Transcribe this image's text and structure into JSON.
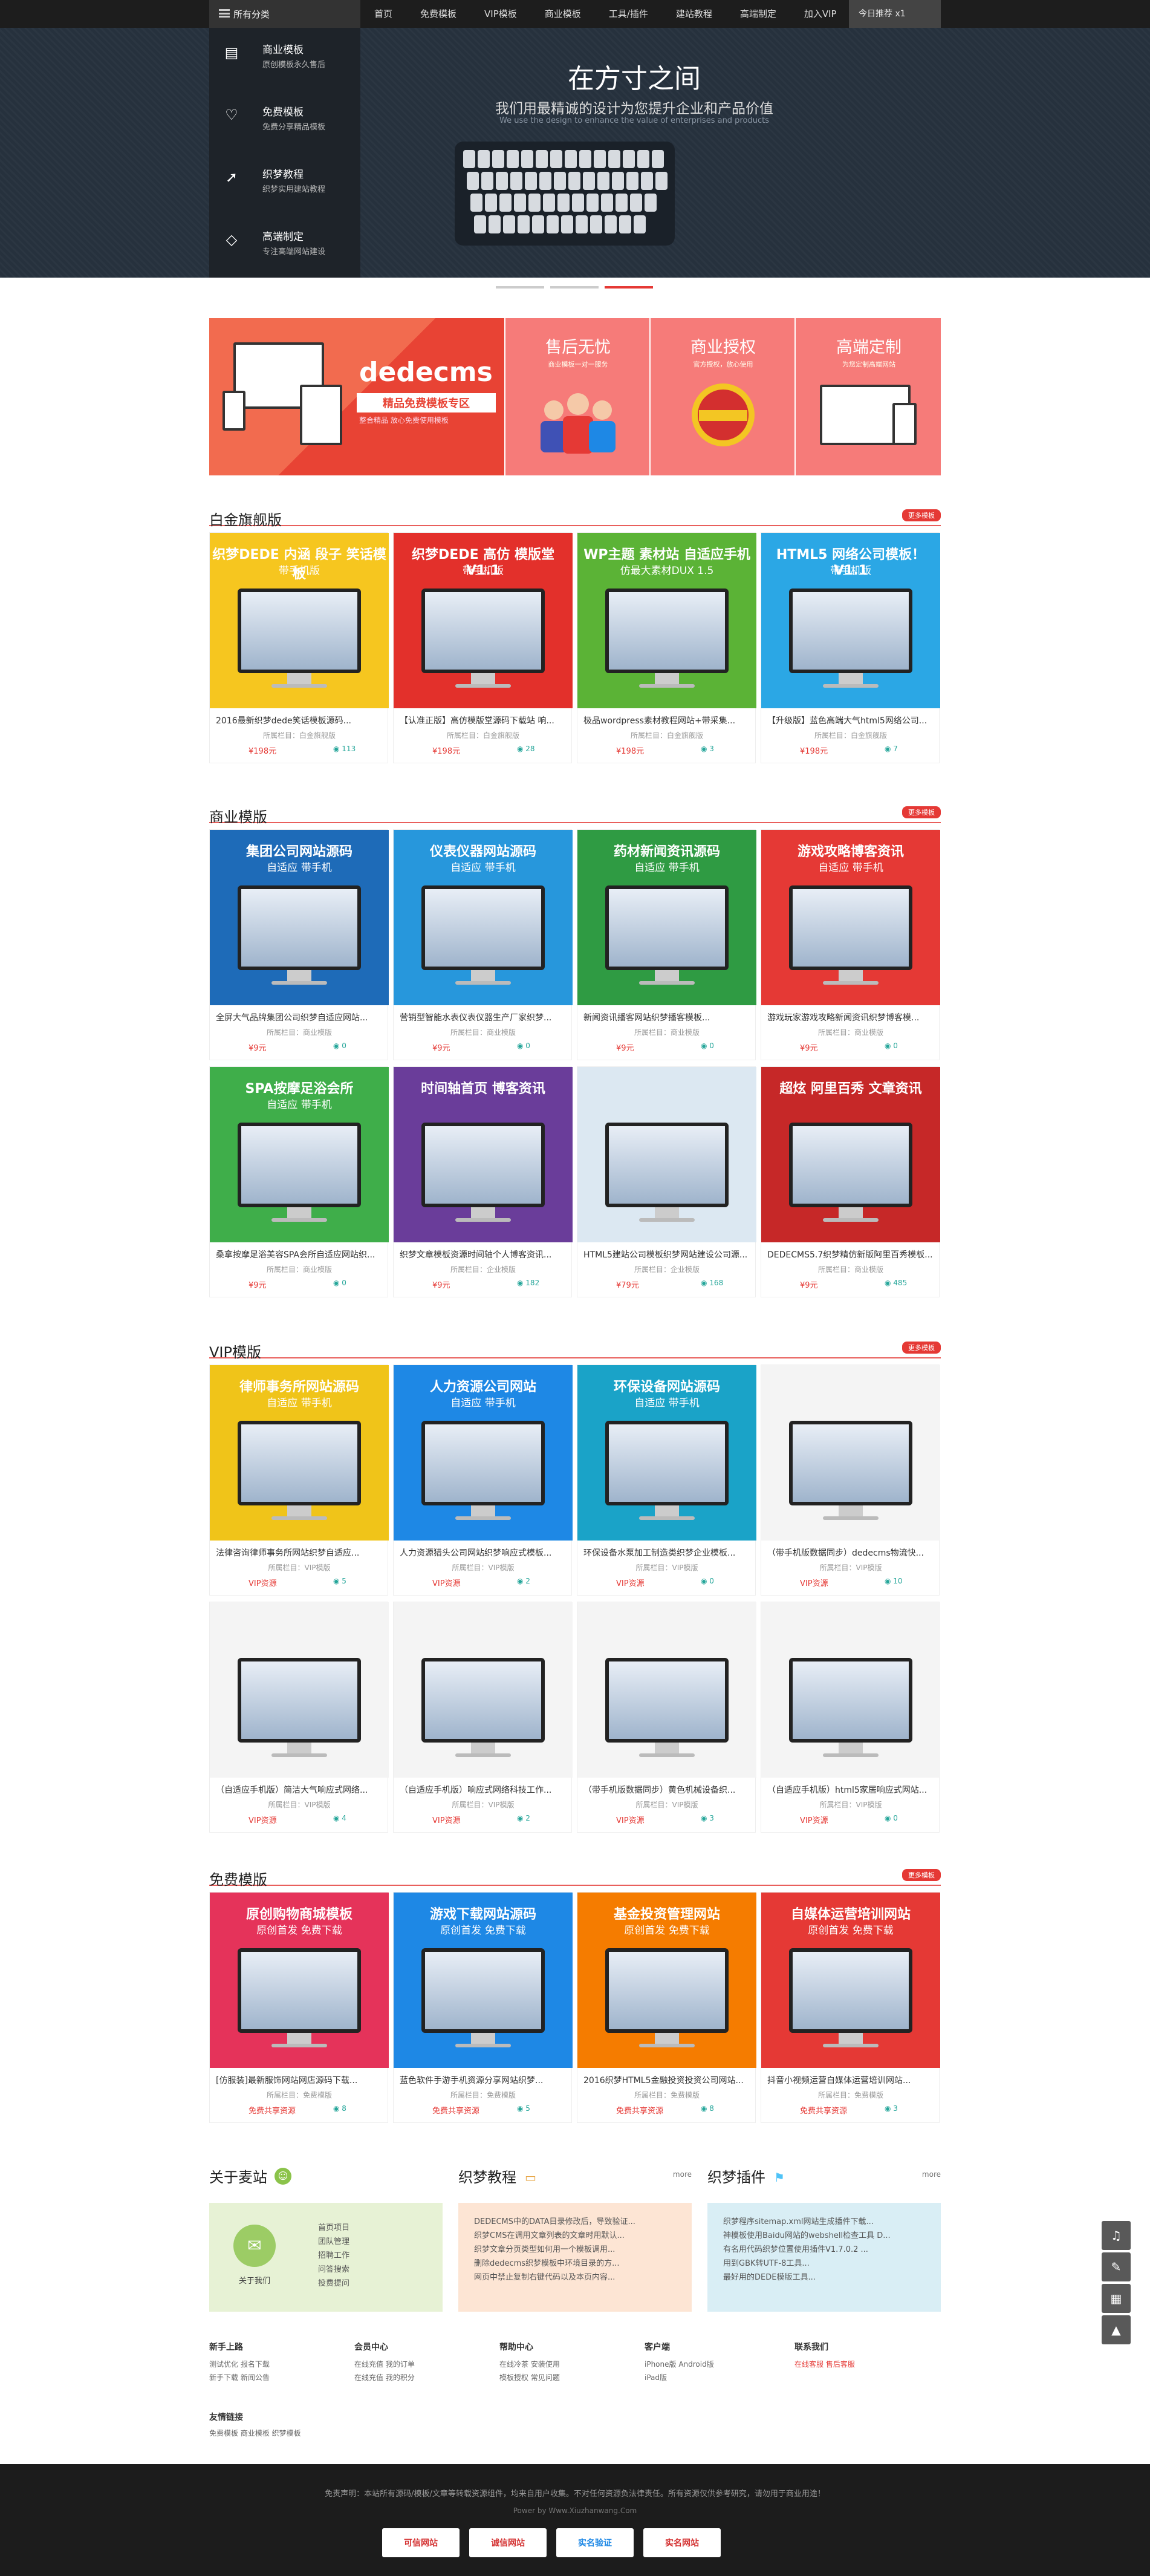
{
  "topnav": {
    "all_categories": "所有分类",
    "items": [
      "首页",
      "免费模板",
      "VIP模板",
      "商业模板",
      "工具/插件",
      "建站教程",
      "高端制定",
      "加入VIP"
    ],
    "today": "今日推荐 x1"
  },
  "hero": {
    "title": "在方寸之间",
    "subtitle": "我们用最精诚的设计为您提升企业和产品价值",
    "en": "We use the design to enhance the value of enterprises and products"
  },
  "sidecat": [
    {
      "icon": "doc-icon",
      "title": "商业模板",
      "desc": "原创模板永久售后"
    },
    {
      "icon": "heart-icon",
      "title": "免费模板",
      "desc": "免费分享精品模板"
    },
    {
      "icon": "cursor-icon",
      "title": "织梦教程",
      "desc": "织梦实用建站教程"
    },
    {
      "icon": "diamond-icon",
      "title": "高端制定",
      "desc": "专注高端网站建设"
    }
  ],
  "promo": {
    "dedecms": "dedecms",
    "dede_sub": "精品免费模板专区",
    "dede_sub2": "整合精品  放心免费使用模板",
    "cols": [
      {
        "h": "售后无忧",
        "s": "商业模板一对一服务"
      },
      {
        "h": "商业授权",
        "s": "官方授权，放心使用"
      },
      {
        "h": "高端定制",
        "s": "为您定制高端网站"
      }
    ]
  },
  "sections": [
    {
      "name": "白金旗舰版",
      "more": "更多模板",
      "cards": [
        {
          "cap": "织梦DEDE 内涵 段子 笑话模板",
          "cap2": "带手机版",
          "bg": "#f6c61f",
          "title": "2016最新织梦dede笑话模板源码...",
          "cat": "所属栏目：白金旗舰版",
          "price": "¥198元",
          "stat": "113"
        },
        {
          "cap": "织梦DEDE 高仿 模版堂 V1.1",
          "cap2": "带手机版",
          "bg": "#e3302b",
          "title": "【认准正版】高仿模版堂源码下载站 响...",
          "cat": "所属栏目：白金旗舰版",
          "price": "¥198元",
          "stat": "28"
        },
        {
          "cap": "WP主题 素材站 自适应手机",
          "cap2": "仿最大素材DUX 1.5",
          "bg": "#5bb336",
          "title": "极品wordpress素材教程网站+带采集...",
          "cat": "所属栏目：白金旗舰版",
          "price": "¥198元",
          "stat": "3"
        },
        {
          "cap": "HTML5 网络公司模板！ V1.1",
          "cap2": "带手机版",
          "bg": "#2ba7e5",
          "title": "【升级版】蓝色高端大气html5网络公司...",
          "cat": "所属栏目：白金旗舰版",
          "price": "¥198元",
          "stat": "7"
        }
      ]
    },
    {
      "name": "商业模版",
      "more": "更多模板",
      "cards": [
        {
          "cap": "集团公司网站源码",
          "cap2": "自适应 带手机",
          "bg": "#1e6bb8",
          "title": "全屏大气品牌集团公司织梦自适应网站...",
          "cat": "所属栏目：商业模版",
          "price": "¥9元",
          "stat": "0"
        },
        {
          "cap": "仪表仪器网站源码",
          "cap2": "自适应 带手机",
          "bg": "#2797dc",
          "title": "营销型智能水表仪表仪器生产厂家织梦...",
          "cat": "所属栏目：商业模版",
          "price": "¥9元",
          "stat": "0"
        },
        {
          "cap": "药材新闻资讯源码",
          "cap2": "自适应 带手机",
          "bg": "#2f9b43",
          "title": "新闻资讯播客网站织梦播客模板...",
          "cat": "所属栏目：商业模版",
          "price": "¥9元",
          "stat": "0"
        },
        {
          "cap": "游戏攻略博客资讯",
          "cap2": "自适应 带手机",
          "bg": "#e53935",
          "title": "游戏玩家游戏攻略新闻资讯织梦博客模...",
          "cat": "所属栏目：商业模版",
          "price": "¥9元",
          "stat": "0"
        },
        {
          "cap": "SPA按摩足浴会所",
          "cap2": "自适应 带手机",
          "bg": "#3fae4a",
          "title": "桑拿按摩足浴美容SPA会所自适应网站织...",
          "cat": "所属栏目：商业模版",
          "price": "¥9元",
          "stat": "0"
        },
        {
          "cap": "时间轴首页 博客资讯",
          "cap2": "",
          "bg": "#6a3d9a",
          "title": "织梦文章模板资源时间轴个人博客资讯...",
          "cat": "所属栏目：企业模版",
          "price": "¥9元",
          "stat": "182"
        },
        {
          "cap": "",
          "cap2": "",
          "bg": "#dce8f2",
          "title": "HTML5建站公司模板织梦网站建设公司源...",
          "cat": "所属栏目：企业模版",
          "price": "¥79元",
          "stat": "168"
        },
        {
          "cap": "超炫 阿里百秀 文章资讯",
          "cap2": "",
          "bg": "#c62828",
          "title": "DEDECMS5.7织梦精仿新版阿里百秀模板...",
          "cat": "所属栏目：商业模版",
          "price": "¥9元",
          "stat": "485"
        }
      ]
    },
    {
      "name": "VIP模版",
      "more": "更多模板",
      "cards": [
        {
          "cap": "律师事务所网站源码",
          "cap2": "自适应 带手机",
          "bg": "#f0c419",
          "title": "法律咨询律师事务所网站织梦自适应...",
          "cat": "所属栏目：VIP模版",
          "price": "VIP资源",
          "stat": "5"
        },
        {
          "cap": "人力资源公司网站",
          "cap2": "自适应 带手机",
          "bg": "#1e88e5",
          "title": "人力资源猎头公司网站织梦响应式模板...",
          "cat": "所属栏目：VIP模版",
          "price": "VIP资源",
          "stat": "2"
        },
        {
          "cap": "环保设备网站源码",
          "cap2": "自适应 带手机",
          "bg": "#1aa3c8",
          "title": "环保设备水泵加工制造类织梦企业模板...",
          "cat": "所属栏目：VIP模版",
          "price": "VIP资源",
          "stat": "0"
        },
        {
          "cap": "",
          "cap2": "",
          "bg": "#f4f4f4",
          "title": "（带手机版数据同步）dedecms物流快...",
          "cat": "所属栏目：VIP模版",
          "price": "VIP资源",
          "stat": "10"
        },
        {
          "cap": "",
          "cap2": "",
          "bg": "#f4f4f4",
          "title": "（自适应手机版）简洁大气响应式网络...",
          "cat": "所属栏目：VIP模版",
          "price": "VIP资源",
          "stat": "4"
        },
        {
          "cap": "",
          "cap2": "",
          "bg": "#f4f4f4",
          "title": "（自适应手机版）响应式网络科技工作...",
          "cat": "所属栏目：VIP模版",
          "price": "VIP资源",
          "stat": "2"
        },
        {
          "cap": "",
          "cap2": "",
          "bg": "#f4f4f4",
          "title": "（带手机版数据同步）黄色机械设备织...",
          "cat": "所属栏目：VIP模版",
          "price": "VIP资源",
          "stat": "3"
        },
        {
          "cap": "",
          "cap2": "",
          "bg": "#f4f4f4",
          "title": "（自适应手机版）html5家居响应式网站...",
          "cat": "所属栏目：VIP模版",
          "price": "VIP资源",
          "stat": "0"
        }
      ]
    },
    {
      "name": "免费模版",
      "more": "更多模板",
      "cards": [
        {
          "cap": "原创购物商城模板",
          "cap2": "原创首发  免费下载",
          "bg": "#e5335a",
          "title": "[仿服装]最新服饰网站网店源码下载...",
          "cat": "所属栏目：免费模版",
          "price": "免费共享资源",
          "stat": "8"
        },
        {
          "cap": "游戏下载网站源码",
          "cap2": "原创首发  免费下载",
          "bg": "#1e88e5",
          "title": "蓝色软件手游手机资源分享网站织梦...",
          "cat": "所属栏目：免费模版",
          "price": "免费共享资源",
          "stat": "5"
        },
        {
          "cap": "基金投资管理网站",
          "cap2": "原创首发  免费下载",
          "bg": "#f57c00",
          "title": "2016织梦HTML5金融投资投资公司网站...",
          "cat": "所属栏目：免费模版",
          "price": "免费共享资源",
          "stat": "8"
        },
        {
          "cap": "自媒体运营培训网站",
          "cap2": "原创首发  免费下载",
          "bg": "#e53935",
          "title": "抖音小视频运营自媒体运营培训网站...",
          "cat": "所属栏目：免费模版",
          "price": "免费共享资源",
          "stat": "3"
        }
      ]
    }
  ],
  "bottom": {
    "about": {
      "h": "关于麦站",
      "btn": "关于我们",
      "items": [
        "首页项目",
        "团队管理",
        "招聘工作",
        "问答搜索",
        "投费提问"
      ]
    },
    "tutorial": {
      "h": "织梦教程",
      "more": "more",
      "items": [
        "DEDECMS中的DATA目录修改后，导致验证...",
        "织梦CMS在调用文章列表的文章时用默认...",
        "织梦文章分页类型如何用一个模板调用...",
        "删除dedecms织梦模板中环境目录的方...",
        "网页中禁止复制右键代码以及本页内容..."
      ]
    },
    "plugin": {
      "h": "织梦插件",
      "more": "more",
      "items": [
        "织梦程序sitemap.xml网站生成插件下载...",
        "神模板使用Baidu网站的webshell检查工具 D...",
        "有名用代码织梦位置使用插件V1.7.0.2 ...",
        "用到GBK转UTF-8工具...",
        "最好用的DEDE模版工具..."
      ]
    }
  },
  "footer_links": [
    {
      "h": "新手上路",
      "rows": [
        "测试优化  报名下载",
        "新手下载  新闻公告"
      ]
    },
    {
      "h": "会员中心",
      "rows": [
        "在线充值  我的订单",
        "在线充值  我的积分"
      ]
    },
    {
      "h": "帮助中心",
      "rows": [
        "在线冷茶  安装使用",
        "模板授权  常见问题"
      ]
    },
    {
      "h": "客户端",
      "rows": [
        "iPhone版    Android版",
        "iPad版"
      ]
    },
    {
      "h": "联系我们",
      "rows": [
        "在线客服    售后客服"
      ]
    }
  ],
  "friends": {
    "h": "友情链接",
    "items": "免费模板   商业模板   织梦模板"
  },
  "footer": {
    "text": "免责声明：本站所有源码/模板/文章等转载资源组件，均来自用户收集。不对任何资源负法律责任。所有资源仅供参考研究，请勿用于商业用途！",
    "power": "Power by Www.Xiuzhanwang.Com",
    "badges": [
      "可信网站",
      "诚信网站",
      "实名验证",
      "实名网站"
    ]
  }
}
